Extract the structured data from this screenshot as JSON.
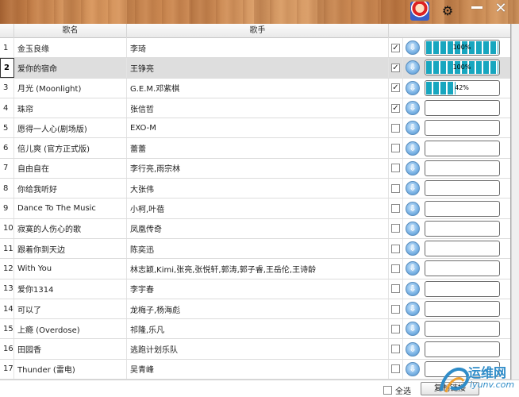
{
  "topbar": {
    "gear_glyph": "⚙",
    "min_label": "",
    "close_glyph": "✕"
  },
  "table": {
    "headers": {
      "title": "歌名",
      "artist": "歌手"
    },
    "rows": [
      {
        "num": "1",
        "title": "金玉良缘",
        "artist": "李琦",
        "checked": true,
        "progress_text": "100%",
        "progress": 100
      },
      {
        "num": "2",
        "title": "爱你的宿命",
        "artist": "王铮亮",
        "checked": true,
        "progress_text": "100%",
        "progress": 100
      },
      {
        "num": "3",
        "title": "月光 (Moonlight)",
        "artist": "G.E.M.邓紫棋",
        "checked": true,
        "progress_text": "42%",
        "progress": 42
      },
      {
        "num": "4",
        "title": "珠帘",
        "artist": "张信哲",
        "checked": true,
        "progress_text": "",
        "progress": 0
      },
      {
        "num": "5",
        "title": "愿得一人心(剧场版)",
        "artist": "EXO-M",
        "checked": false,
        "progress_text": "",
        "progress": 0
      },
      {
        "num": "6",
        "title": "倍儿爽 (官方正式版)",
        "artist": "蕾蕾",
        "checked": false,
        "progress_text": "",
        "progress": 0
      },
      {
        "num": "7",
        "title": "自由自在",
        "artist": "李行亮,雨宗林",
        "checked": false,
        "progress_text": "",
        "progress": 0
      },
      {
        "num": "8",
        "title": "你给我听好",
        "artist": "大张伟",
        "checked": false,
        "progress_text": "",
        "progress": 0
      },
      {
        "num": "9",
        "title": "Dance To The Music",
        "artist": "小柯,叶蓓",
        "checked": false,
        "progress_text": "",
        "progress": 0
      },
      {
        "num": "10",
        "title": "寂寞的人伤心的歌",
        "artist": "凤凰传奇",
        "checked": false,
        "progress_text": "",
        "progress": 0
      },
      {
        "num": "11",
        "title": "跟着你到天边",
        "artist": "陈奕迅",
        "checked": false,
        "progress_text": "",
        "progress": 0
      },
      {
        "num": "12",
        "title": "With You",
        "artist": "林志颖,Kimi,张亮,张悦轩,郭涛,郭子睿,王岳伦,王诗龄",
        "checked": false,
        "progress_text": "",
        "progress": 0
      },
      {
        "num": "13",
        "title": "爱你1314",
        "artist": "李宇春",
        "checked": false,
        "progress_text": "",
        "progress": 0
      },
      {
        "num": "14",
        "title": "可以了",
        "artist": "龙梅子,杨海彪",
        "checked": false,
        "progress_text": "",
        "progress": 0
      },
      {
        "num": "15",
        "title": "上瘾 (Overdose)",
        "artist": "祁隆,乐凡",
        "checked": false,
        "progress_text": "",
        "progress": 0
      },
      {
        "num": "16",
        "title": "田园香",
        "artist": "逃跑计划乐队",
        "checked": false,
        "progress_text": "",
        "progress": 0
      },
      {
        "num": "17",
        "title": "Thunder (雷电)",
        "artist": "吴青峰",
        "checked": false,
        "progress_text": "",
        "progress": 0
      }
    ],
    "selected_row": 1
  },
  "footer": {
    "select_all_label": "全选",
    "copy_button_label": "复制链接"
  },
  "watermark": {
    "cn": "运维网",
    "en": "iyunv.com"
  },
  "icons": {
    "download_glyph": "⇩",
    "check_glyph": "✓"
  }
}
